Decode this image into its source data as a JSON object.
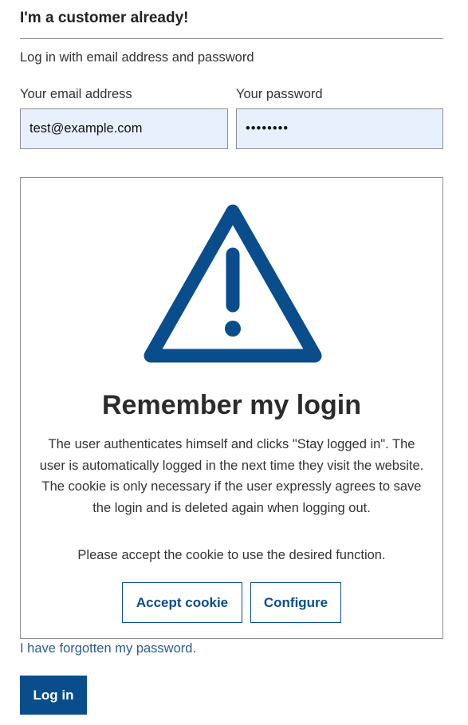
{
  "login": {
    "heading": "I'm a customer already!",
    "subtitle": "Log in with email address and password",
    "email": {
      "label": "Your email address",
      "value": "test@example.com"
    },
    "password": {
      "label": "Your password",
      "value": "••••••••"
    },
    "forgot_link": "I have forgotten my password.",
    "submit_label": "Log in"
  },
  "consent": {
    "icon": "warning-triangle-icon",
    "title": "Remember my login",
    "description": "The user authenticates himself and clicks \"Stay logged in\". The user is automatically logged in the next time they visit the website. The cookie is only necessary if the user expressly agrees to save the login and is deleted again when logging out.",
    "note": "Please accept the cookie to use the desired function.",
    "accept_label": "Accept cookie",
    "configure_label": "Configure"
  },
  "colors": {
    "primary": "#0a4d8c",
    "link": "#2a5e8e",
    "autofill_bg": "#e8f0fe",
    "border": "#8f8f8f"
  }
}
